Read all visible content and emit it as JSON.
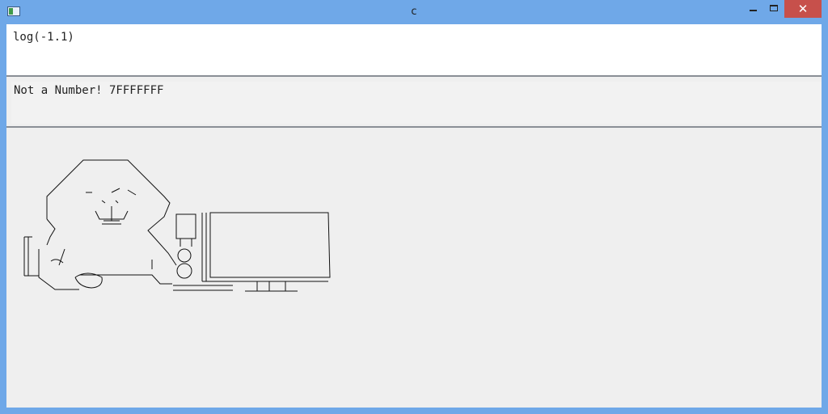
{
  "window": {
    "title": "c"
  },
  "controls": {
    "minimize_glyph": "",
    "maximize_glyph": "",
    "close_glyph": "✕"
  },
  "input": {
    "expression": "log(-1.1)"
  },
  "output": {
    "result": "Not a Number! 7FFFFFFF"
  },
  "art": {
    "caption": ""
  },
  "colors": {
    "frame": "#6fa8e8",
    "close_button": "#c7504b",
    "pane": "#efefef",
    "input_bg": "#ffffff",
    "splitter": "#8a8f96"
  }
}
